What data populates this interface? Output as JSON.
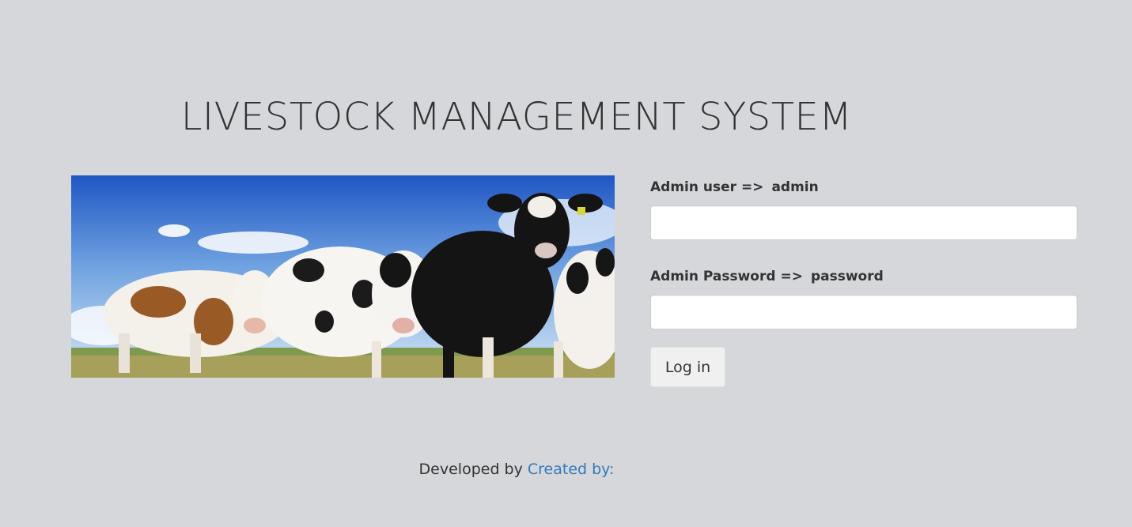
{
  "page": {
    "title": "LIVESTOCK MANAGEMENT SYSTEM"
  },
  "hero": {
    "image_alt": "herd of cows in a field"
  },
  "login": {
    "username_label": "Admin user =>",
    "username_hint": "admin",
    "username_value": "",
    "password_label": "Admin Password =>",
    "password_hint": "password",
    "password_value": "",
    "submit_label": "Log in"
  },
  "footer": {
    "prefix": "Developed by",
    "link_text": "Created by:"
  },
  "colors": {
    "background": "#d5d7db",
    "text": "#333333",
    "link": "#337ab7"
  }
}
